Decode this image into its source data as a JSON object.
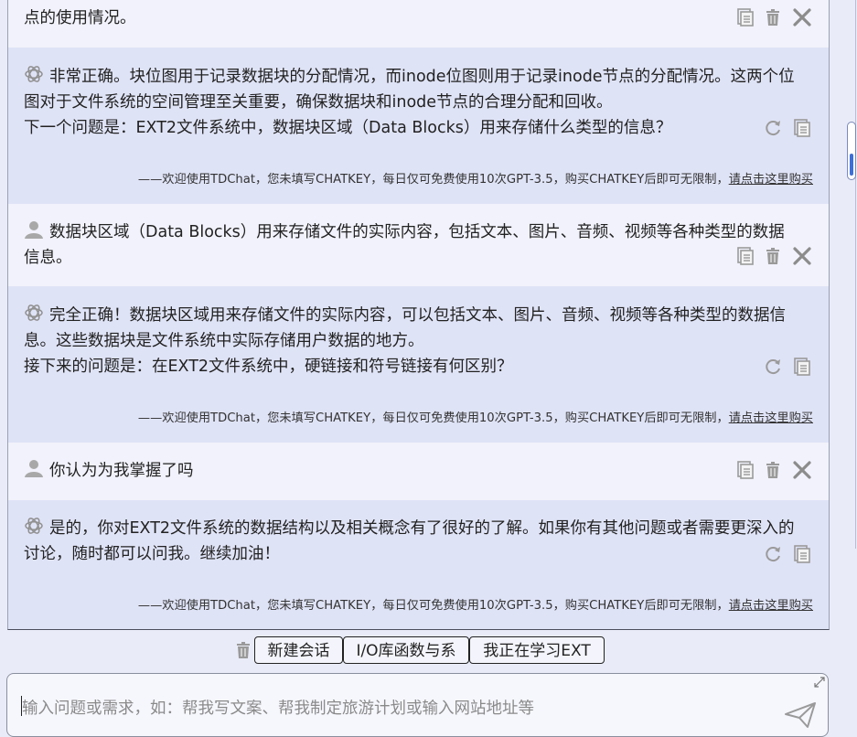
{
  "messages": [
    {
      "role": "user",
      "lines": [
        "点的使用情况。"
      ]
    },
    {
      "role": "assistant",
      "lines": [
        "非常正确。块位图用于记录数据块的分配情况，而inode位图则用于记录inode节点的分配情况。这两个位图对于文件系统的空间管理至关重要，确保数据块和inode节点的合理分配和回收。",
        "下一个问题是：EXT2文件系统中，数据块区域（Data Blocks）用来存储什么类型的信息？"
      ]
    },
    {
      "role": "user",
      "lines": [
        "数据块区域（Data Blocks）用来存储文件的实际内容，包括文本、图片、音频、视频等各种类型的数据信息。"
      ]
    },
    {
      "role": "assistant",
      "lines": [
        "完全正确！数据块区域用来存储文件的实际内容，可以包括文本、图片、音频、视频等各种类型的数据信息。这些数据块是文件系统中实际存储用户数据的地方。",
        "接下来的问题是：在EXT2文件系统中，硬链接和符号链接有何区别？"
      ]
    },
    {
      "role": "user",
      "lines": [
        "你认为为我掌握了吗"
      ]
    },
    {
      "role": "assistant",
      "lines": [
        "是的，你对EXT2文件系统的数据结构以及相关概念有了很好的了解。如果你有其他问题或者需要更深入的讨论，随时都可以问我。继续加油！"
      ]
    }
  ],
  "footer": {
    "notice": "——欢迎使用TDChat，您未填写CHATKEY，每日仅可免费使用10次GPT-3.5，购买CHATKEY后即可无限制，",
    "link": "请点击这里购买"
  },
  "toolbar": {
    "buttons": [
      "新建会话",
      "I/O库函数与系",
      "我正在学习EXT"
    ]
  },
  "input": {
    "placeholder": "输入问题或需求，如：帮我写文案、帮我制定旅游计划或输入网站地址等"
  }
}
